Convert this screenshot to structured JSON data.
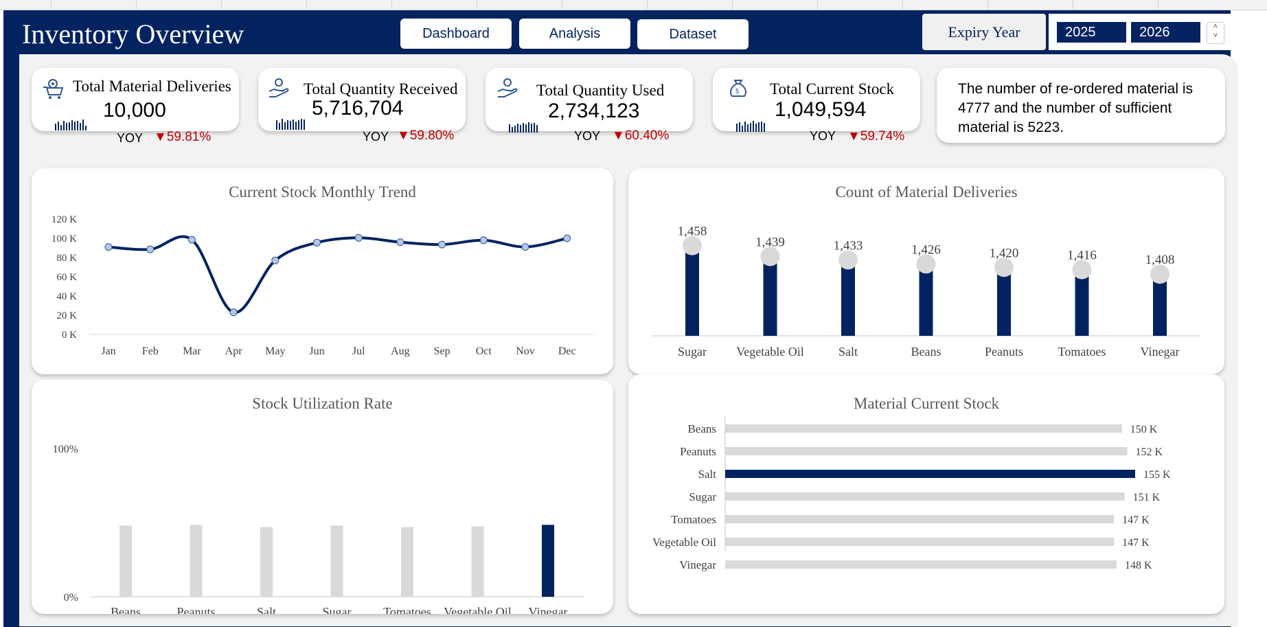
{
  "header": {
    "title": "Inventory Overview",
    "nav": [
      "Dashboard",
      "Analysis",
      "Dataset"
    ],
    "expiry_label": "Expiry Year",
    "years": [
      "2025",
      "2026"
    ]
  },
  "kpis": [
    {
      "title": "Total Material Deliveries",
      "value": "10,000",
      "yoy_label": "YOY",
      "yoy": "59.81%",
      "icon": "delivery-cart-icon"
    },
    {
      "title": "Total Quantity Received",
      "value": "5,716,704",
      "yoy_label": "YOY",
      "yoy": "59.80%",
      "icon": "hand-coins-icon"
    },
    {
      "title": "Total Quantity Used",
      "value": "2,734,123",
      "yoy_label": "YOY",
      "yoy": "60.40%",
      "icon": "hand-coins-icon"
    },
    {
      "title": "Total Current Stock",
      "value": "1,049,594",
      "yoy_label": "YOY",
      "yoy": "59.74%",
      "icon": "money-bag-icon"
    }
  ],
  "summary": "The number of re-ordered material is 4777 and the number of sufficient material is 5223.",
  "colors": {
    "navy": "#032360",
    "light_gray": "#d9d9d9",
    "red": "#c00000"
  },
  "chart_data": [
    {
      "type": "line",
      "title": "Current Stock Monthly Trend",
      "x": [
        "Jan",
        "Feb",
        "Mar",
        "Apr",
        "May",
        "Jun",
        "Jul",
        "Aug",
        "Sep",
        "Oct",
        "Nov",
        "Dec"
      ],
      "y": [
        91000,
        88500,
        98500,
        23000,
        77000,
        95500,
        100500,
        96000,
        93500,
        98000,
        91000,
        100000
      ],
      "yticks": [
        "0 K",
        "20 K",
        "40 K",
        "60 K",
        "80 K",
        "100 K",
        "120 K"
      ],
      "ylim": [
        0,
        120000
      ],
      "color": "#032360"
    },
    {
      "type": "bar",
      "title": "Count of Material Deliveries",
      "categories": [
        "Sugar",
        "Vegetable Oil",
        "Salt",
        "Beans",
        "Peanuts",
        "Tomatoes",
        "Vinegar"
      ],
      "values": [
        1458,
        1439,
        1433,
        1426,
        1420,
        1416,
        1408
      ],
      "labels": [
        "1,458",
        "1,439",
        "1,433",
        "1,426",
        "1,420",
        "1,416",
        "1,408"
      ],
      "color": "#032360"
    },
    {
      "type": "bar",
      "title": "Stock Utilization Rate",
      "categories": [
        "Beans",
        "Peanuts",
        "Salt",
        "Sugar",
        "Tomatoes",
        "Vegetable Oil",
        "Vinegar"
      ],
      "values": [
        48,
        48.5,
        47,
        48,
        47,
        47.5,
        48.5
      ],
      "highlight": "Vinegar",
      "yticks": [
        "0%",
        "100%"
      ],
      "ylim": [
        0,
        100
      ]
    },
    {
      "type": "bar",
      "orientation": "horizontal",
      "title": "Material Current Stock",
      "categories": [
        "Beans",
        "Peanuts",
        "Salt",
        "Sugar",
        "Tomatoes",
        "Vegetable Oil",
        "Vinegar"
      ],
      "values": [
        150,
        152,
        155,
        151,
        147,
        147,
        148
      ],
      "labels": [
        "150 K",
        "152 K",
        "155 K",
        "151 K",
        "147 K",
        "147 K",
        "148 K"
      ],
      "highlight": "Salt"
    }
  ]
}
